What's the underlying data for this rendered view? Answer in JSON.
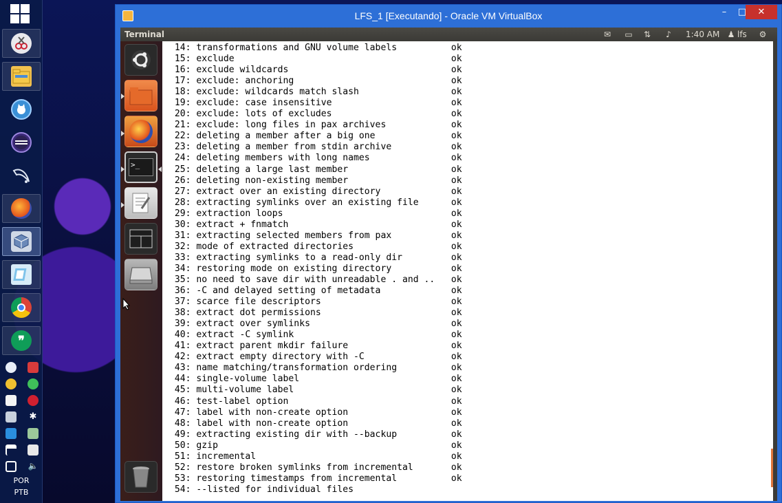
{
  "host": {
    "taskbar": {
      "apps": [
        {
          "name": "pinned-app-1",
          "icon": "scissors-tool-icon"
        },
        {
          "name": "file-explorer",
          "icon": "folder-icon"
        },
        {
          "name": "cat-app",
          "icon": "cat-icon"
        },
        {
          "name": "eclipse",
          "icon": "eclipse-icon"
        },
        {
          "name": "mysql-workbench",
          "icon": "dolphin-icon"
        },
        {
          "name": "firefox",
          "icon": "firefox-icon"
        },
        {
          "name": "virtualbox",
          "icon": "virtualbox-icon"
        },
        {
          "name": "notes",
          "icon": "notepad-icon"
        },
        {
          "name": "chrome",
          "icon": "chrome-icon"
        },
        {
          "name": "hangouts",
          "icon": "hangouts-icon"
        }
      ],
      "language": "POR",
      "keyboard": "PTB"
    }
  },
  "window": {
    "title": "LFS_1 [Executando] - Oracle VM VirtualBox",
    "minimize_glyph": "–",
    "maximize_glyph": "□",
    "close_glyph": "✕"
  },
  "guest": {
    "panel": {
      "title": "Terminal",
      "time": "1:40 AM",
      "user": "lfs"
    },
    "launcher": [
      {
        "name": "ubuntu-dash",
        "icon": "ubuntu-logo-icon"
      },
      {
        "name": "files",
        "icon": "folder-icon"
      },
      {
        "name": "firefox",
        "icon": "firefox-icon"
      },
      {
        "name": "terminal",
        "icon": "terminal-icon",
        "glyph": ">_"
      },
      {
        "name": "text-editor",
        "icon": "text-editor-icon"
      },
      {
        "name": "workspace-switcher",
        "icon": "workspace-icon"
      },
      {
        "name": "disk",
        "icon": "disk-icon"
      },
      {
        "name": "trash",
        "icon": "trash-icon"
      }
    ],
    "terminal": {
      "lines": [
        " 14: transformations and GNU volume labels          ok",
        " 15: exclude                                        ok",
        " 16: exclude wildcards                              ok",
        " 17: exclude: anchoring                             ok",
        " 18: exclude: wildcards match slash                 ok",
        " 19: exclude: case insensitive                      ok",
        " 20: exclude: lots of excludes                      ok",
        " 21: exclude: long files in pax archives            ok",
        " 22: deleting a member after a big one              ok",
        " 23: deleting a member from stdin archive           ok",
        " 24: deleting members with long names               ok",
        " 25: deleting a large last member                   ok",
        " 26: deleting non-existing member                   ok",
        " 27: extract over an existing directory             ok",
        " 28: extracting symlinks over an existing file      ok",
        " 29: extraction loops                               ok",
        " 30: extract + fnmatch                              ok",
        " 31: extracting selected members from pax           ok",
        " 32: mode of extracted directories                  ok",
        " 33: extracting symlinks to a read-only dir         ok",
        " 34: restoring mode on existing directory           ok",
        " 35: no need to save dir with unreadable . and ..   ok",
        " 36: -C and delayed setting of metadata             ok",
        " 37: scarce file descriptors                        ok",
        " 38: extract dot permissions                        ok",
        " 39: extract over symlinks                          ok",
        " 40: extract -C symlink                             ok",
        " 41: extract parent mkdir failure                   ok",
        " 42: extract empty directory with -C                ok",
        " 43: name matching/transformation ordering          ok",
        " 44: single-volume label                            ok",
        " 45: multi-volume label                             ok",
        " 46: test-label option                              ok",
        " 47: label with non-create option                   ok",
        " 48: label with non-create option                   ok",
        " 49: extracting existing dir with --backup          ok",
        " 50: gzip                                           ok",
        " 51: incremental                                    ok",
        " 52: restore broken symlinks from incremental       ok",
        " 53: restoring timestamps from incremental          ok",
        " 54: --listed for individual files"
      ]
    }
  },
  "colors": {
    "titlebar": "#2d6fd7",
    "close_button": "#c7312c",
    "panel": "#3c3b37",
    "launcher": "#3a1e1a",
    "terminal_bg": "#ffffff",
    "scroll_accent": "#e0763a"
  }
}
